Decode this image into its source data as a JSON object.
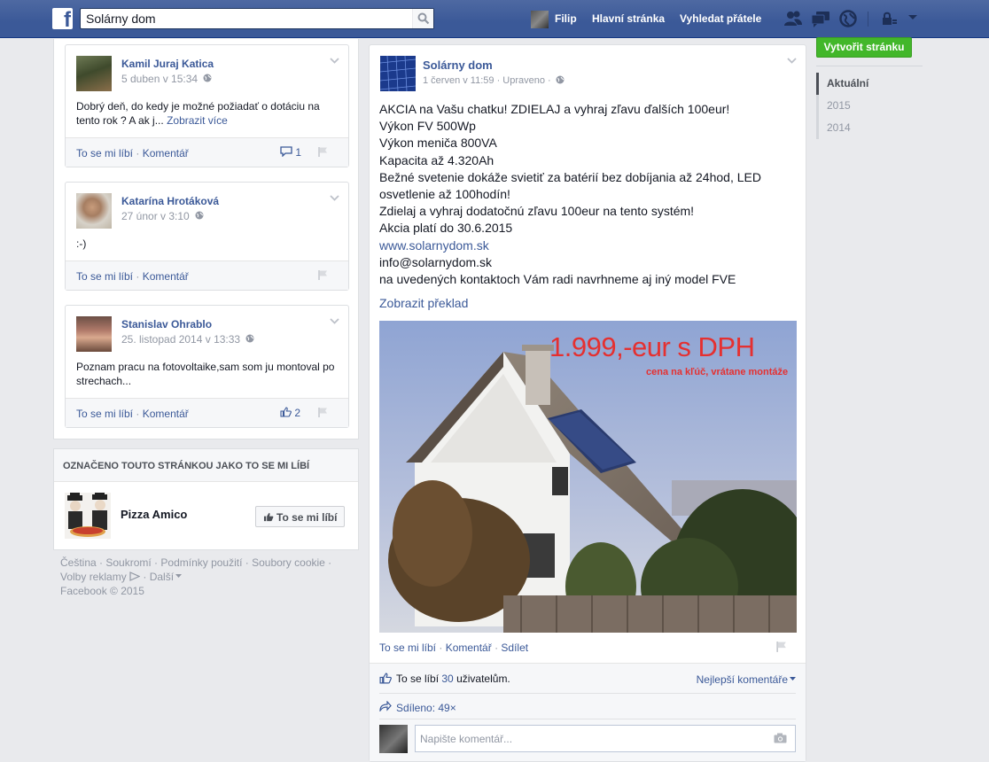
{
  "topbar": {
    "search_value": "Solárny dom",
    "user_name": "Filip",
    "home_label": "Hlavní stránka",
    "find_friends_label": "Vyhledat přátele"
  },
  "left_comments": [
    {
      "name": "Kamil Juraj Katica",
      "time": "5 duben v 15:34",
      "text": "Dobrý deň, do kedy je možné požiadať o dotáciu na tento rok ? A ak j...",
      "see_more": "Zobrazit více",
      "like_label": "To se mi líbí",
      "comment_label": "Komentář",
      "count": "1",
      "count_type": "comment"
    },
    {
      "name": "Katarína Hrotáková",
      "time": "27 únor v 3:10",
      "text": ":-)",
      "like_label": "To se mi líbí",
      "comment_label": "Komentář"
    },
    {
      "name": "Stanislav Ohrablo",
      "time": "25. listopad 2014 v 13:33",
      "text": "Poznam pracu na fotovoltaike,sam som ju montoval po strechach...",
      "like_label": "To se mi líbí",
      "comment_label": "Komentář",
      "count": "2",
      "count_type": "like"
    }
  ],
  "liked_section": {
    "title": "OZNAČENO TOUTO STRÁNKOU JAKO TO SE MI LÍBÍ",
    "page_name": "Pizza Amico",
    "like_button": "To se mi líbí"
  },
  "footer": {
    "links": [
      "Čeština",
      "Soukromí",
      "Podmínky použití",
      "Soubory cookie",
      "Volby reklamy",
      "Další"
    ],
    "copyright": "Facebook © 2015"
  },
  "post": {
    "page_name": "Solárny dom",
    "meta": "1 červen v 11:59 · Upraveno ·",
    "lines": [
      "AKCIA na Vašu chatku! ZDIELAJ a vyhraj zľavu ďalších 100eur!",
      "Výkon FV 500Wp",
      "Výkon meniča 800VA",
      "Kapacita až 4.320Ah",
      "Bežné svetenie dokáže svietiť za batérií bez dobíjania až 24hod, LED osvetlenie až 100hodín!",
      "Zdielaj a vyhraj dodatočnú zľavu 100eur na tento systém!",
      "Akcia platí do 30.6.2015"
    ],
    "link": "www.solarnydom.sk",
    "lines_after": [
      "info@solarnydom.sk",
      "na uvedených kontaktoch Vám radi navrhneme aj iný model FVE"
    ],
    "translate": "Zobrazit překlad",
    "image_price": "1.999,-eur s DPH",
    "image_subtitle": "cena na kľúč, vrátane montáže",
    "actions": [
      "To se mi líbí",
      "Komentář",
      "Sdílet"
    ],
    "likes_prefix": "To se líbí",
    "likes_count": "30",
    "likes_suffix": "uživatelům.",
    "best_comments": "Nejlepší komentáře",
    "shared": "Sdíleno: 49×",
    "comment_placeholder": "Napište komentář..."
  },
  "right": {
    "create_page": "Vytvořit stránku",
    "years": [
      "Aktuální",
      "2015",
      "2014"
    ]
  }
}
